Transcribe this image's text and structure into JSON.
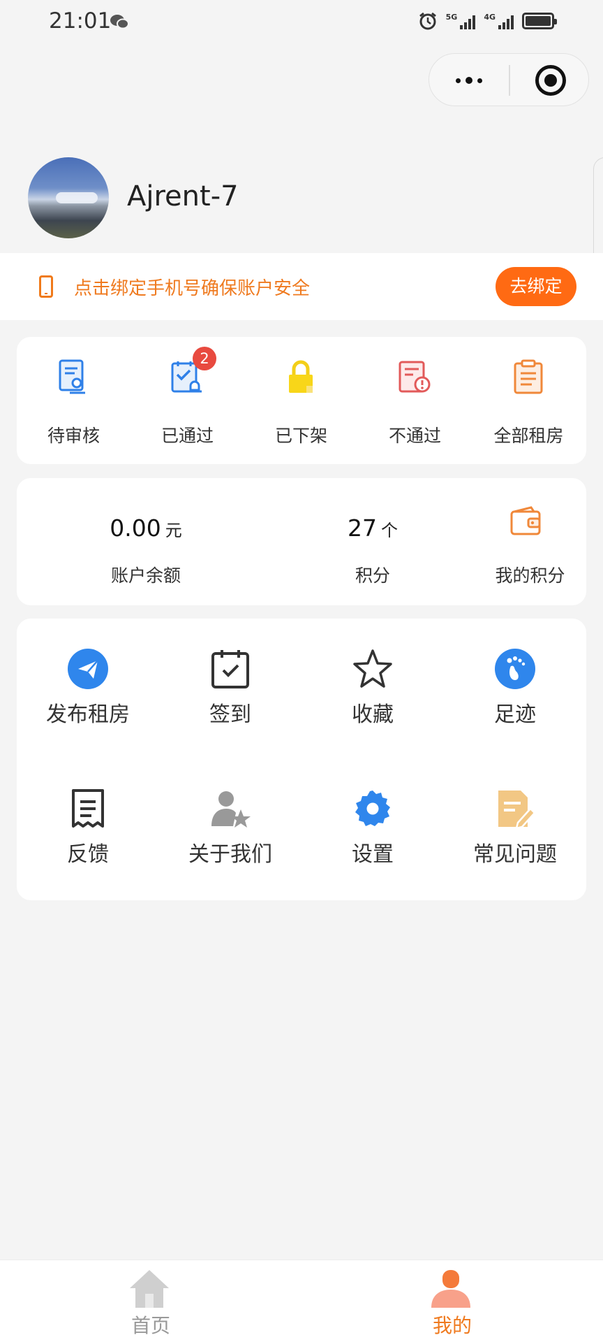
{
  "status_bar": {
    "time": "21:01",
    "network_1": "5G",
    "network_2": "4G"
  },
  "profile": {
    "username": "Ajrent-7"
  },
  "bind_phone": {
    "text": "点击绑定手机号确保账户安全",
    "button_label": "去绑定"
  },
  "listing_status": {
    "items": [
      {
        "label": "待审核",
        "icon": "pending-review-icon"
      },
      {
        "label": "已通过",
        "icon": "approved-icon",
        "badge": "2"
      },
      {
        "label": "已下架",
        "icon": "lock-icon"
      },
      {
        "label": "不通过",
        "icon": "rejected-icon"
      },
      {
        "label": "全部租房",
        "icon": "clipboard-icon"
      }
    ]
  },
  "account": {
    "balance_value": "0.00",
    "balance_unit": "元",
    "balance_label": "账户余额",
    "points_value": "27",
    "points_unit": "个",
    "points_label": "积分",
    "my_points_label": "我的积分"
  },
  "menu": {
    "items": [
      {
        "label": "发布租房",
        "icon": "send-icon"
      },
      {
        "label": "签到",
        "icon": "calendar-check-icon"
      },
      {
        "label": "收藏",
        "icon": "star-icon"
      },
      {
        "label": "足迹",
        "icon": "footprint-icon"
      },
      {
        "label": "反馈",
        "icon": "receipt-icon"
      },
      {
        "label": "关于我们",
        "icon": "user-star-icon"
      },
      {
        "label": "设置",
        "icon": "gear-icon"
      },
      {
        "label": "常见问题",
        "icon": "document-edit-icon"
      }
    ]
  },
  "tabbar": {
    "home_label": "首页",
    "mine_label": "我的"
  },
  "colors": {
    "accent": "#ff6a13",
    "accent_text": "#ef7a1f",
    "badge": "#e84a3f",
    "blue": "#2f80e8"
  }
}
